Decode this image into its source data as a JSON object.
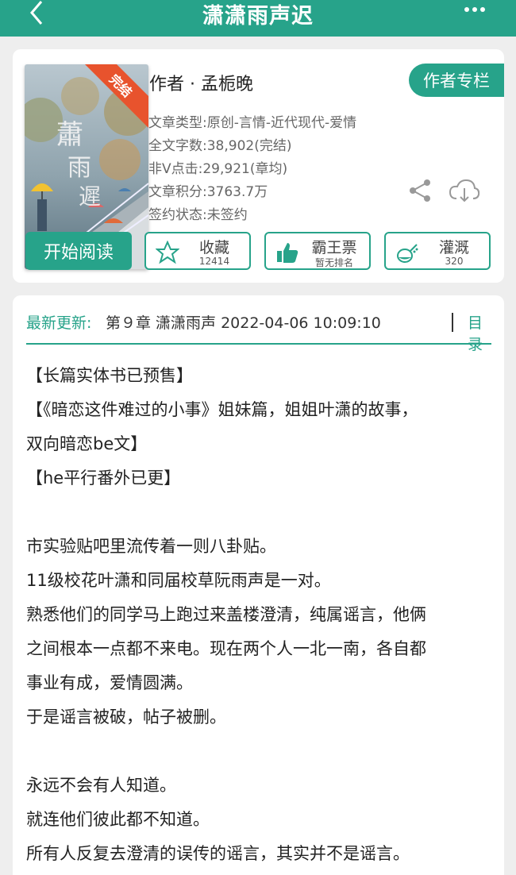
{
  "header": {
    "title": "潇潇雨声迟",
    "back_icon": "chevron-left-icon",
    "more_icon": "more-horizontal-icon"
  },
  "book": {
    "cover_badge": "完结",
    "author": "作者 · 孟栀晚",
    "author_button": "作者专栏",
    "meta": [
      "文章类型:原创-言情-近代现代-爱情",
      "全文字数:38,902(完结)",
      "非Ⅴ点击:29,921(章均)",
      "文章积分:3763.7万",
      "签约状态:未签约"
    ],
    "share_icon": "share-icon",
    "download_icon": "cloud-download-icon"
  },
  "actions": {
    "read": "开始阅读",
    "favorite": {
      "label": "收藏",
      "count": "12414",
      "icon": "star-icon"
    },
    "bawang": {
      "label": "霸王票",
      "sub": "暂无排名",
      "icon": "thumbs-up-icon"
    },
    "irrigate": {
      "label": "灌溉",
      "count": "320",
      "icon": "watering-can-icon"
    }
  },
  "update": {
    "label": "最新更新:",
    "text": "第９章 潇潇雨声 2022-04-06 10:09:10",
    "toc": "目录"
  },
  "intro": [
    "【长篇实体书已预售】",
    "【《暗恋这件难过的小事》姐妹篇，姐姐叶潇的故事，",
    "双向暗恋be文】",
    "【he平行番外已更】",
    "",
    "市实验贴吧里流传着一则八卦贴。",
    "11级校花叶潇和同届校草阮雨声是一对。",
    "熟悉他们的同学马上跑过来盖楼澄清，纯属谣言，他俩",
    "之间根本一点都不来电。现在两个人一北一南，各自都",
    "事业有成，爱情圆满。",
    "于是谣言被破，帖子被删。",
    "",
    "永远不会有人知道。",
    "就连他们彼此都不知道。",
    "所有人反复去澄清的误传的谣言，其实并不是谣言。"
  ],
  "colors": {
    "accent": "#27a38a",
    "badge": "#e8532d"
  }
}
